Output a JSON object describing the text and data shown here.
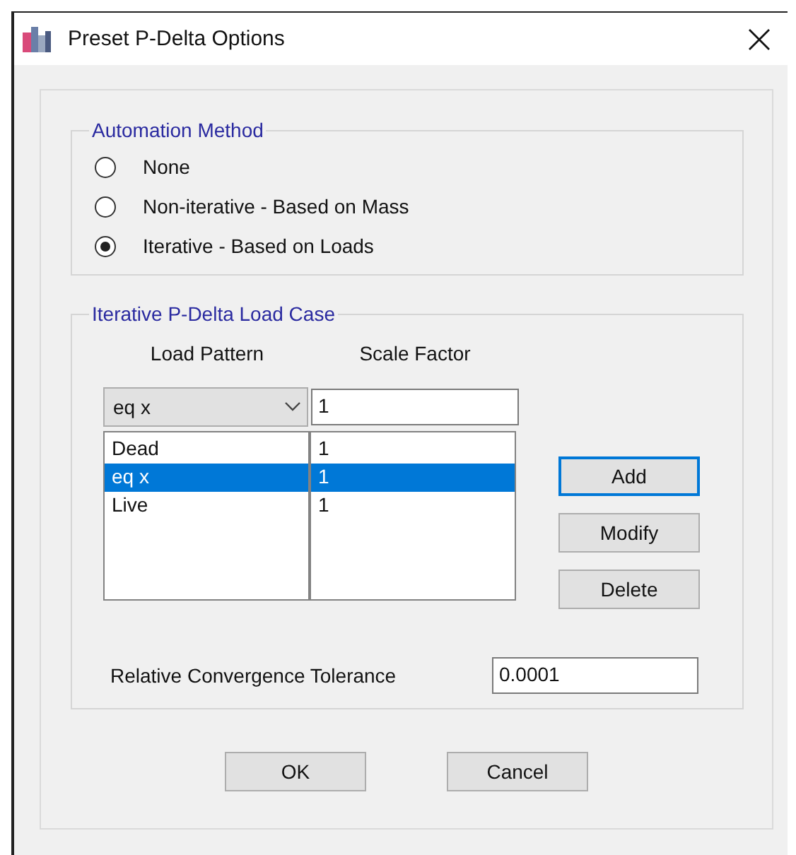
{
  "window": {
    "title": "Preset P-Delta Options"
  },
  "automation_method": {
    "title": "Automation Method",
    "options": [
      {
        "label": "None",
        "selected": false
      },
      {
        "label": "Non-iterative - Based on Mass",
        "selected": false
      },
      {
        "label": "Iterative - Based on Loads",
        "selected": true
      }
    ]
  },
  "load_case": {
    "title": "Iterative P-Delta Load Case",
    "columns": [
      "Load Pattern",
      "Scale Factor"
    ],
    "load_pattern_dropdown": "eq x",
    "scale_factor_input": "1",
    "rows": [
      {
        "load_pattern": "Dead",
        "scale_factor": "1",
        "selected": false
      },
      {
        "load_pattern": "eq x",
        "scale_factor": "1",
        "selected": true
      },
      {
        "load_pattern": "Live",
        "scale_factor": "1",
        "selected": false
      }
    ],
    "buttons": [
      {
        "label": "Add",
        "focused": true
      },
      {
        "label": "Modify",
        "focused": false
      },
      {
        "label": "Delete",
        "focused": false
      }
    ],
    "tolerance": {
      "label": "Relative Convergence Tolerance",
      "value": "0.0001"
    }
  },
  "buttons": [
    "OK",
    "Cancel"
  ]
}
